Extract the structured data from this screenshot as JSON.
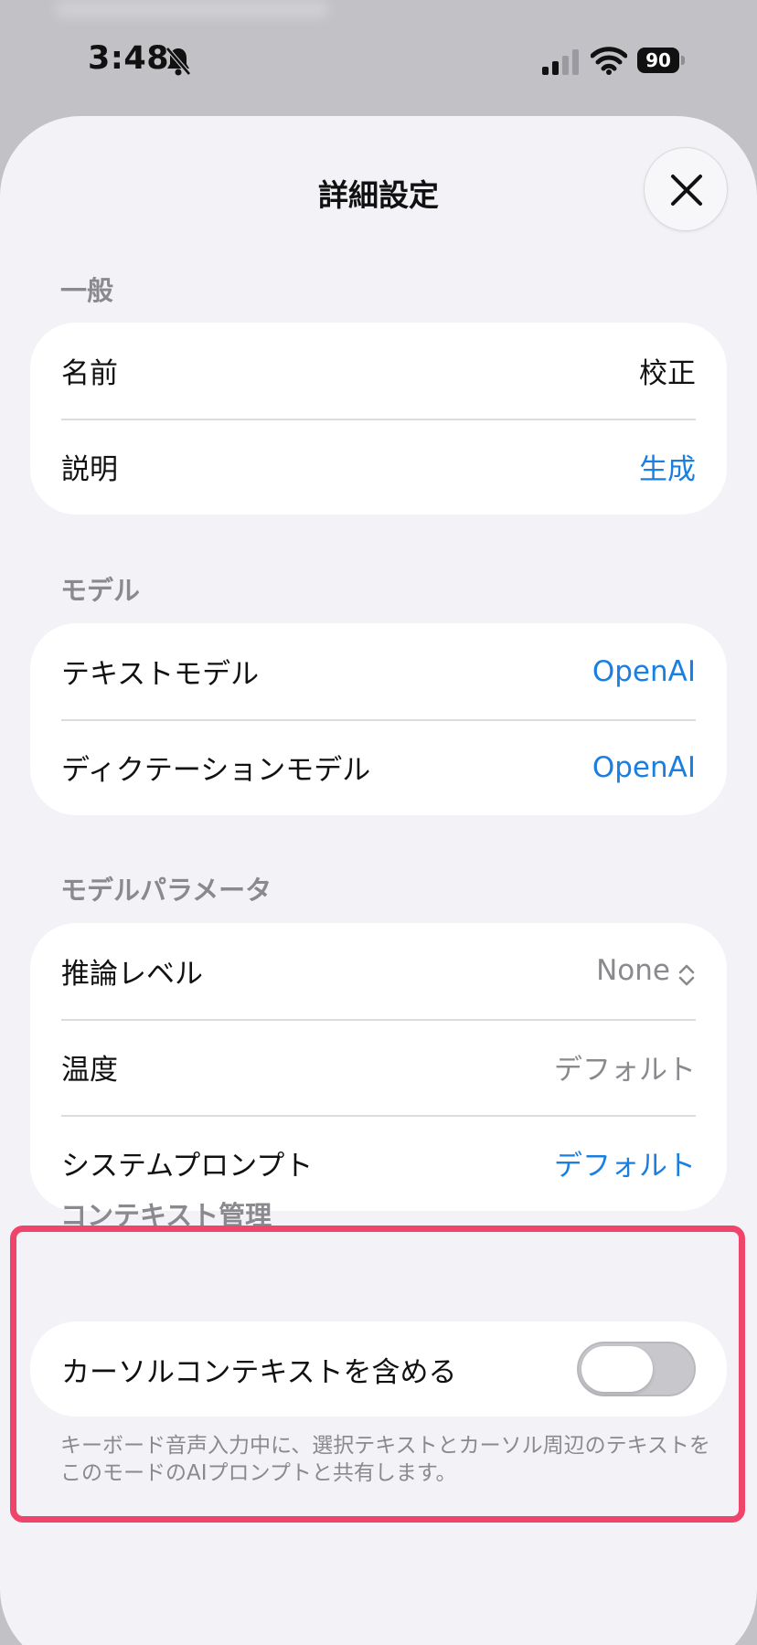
{
  "status_bar": {
    "time": "3:48",
    "battery": "90",
    "icons": [
      "bell-slash-icon",
      "cellular-signal-icon",
      "wifi-icon",
      "battery-icon"
    ]
  },
  "sheet": {
    "title": "詳細設定",
    "close_icon": "close-icon"
  },
  "sections": {
    "general": {
      "header": "一般",
      "rows": [
        {
          "label": "名前",
          "value": "校正"
        },
        {
          "label": "説明",
          "value": "生成"
        }
      ]
    },
    "model": {
      "header": "モデル",
      "rows": [
        {
          "label": "テキストモデル",
          "value": "OpenAI"
        },
        {
          "label": "ディクテーションモデル",
          "value": "OpenAI"
        }
      ]
    },
    "params": {
      "header": "モデルパラメータ",
      "rows": [
        {
          "label": "推論レベル",
          "value": "None"
        },
        {
          "label": "温度",
          "value": "デフォルト"
        },
        {
          "label": "システムプロンプト",
          "value": "デフォルト"
        }
      ]
    },
    "context": {
      "header": "コンテキスト管理",
      "toggle_label": "カーソルコンテキストを含める",
      "toggle_on": false,
      "footnote": "キーボード音声入力中に、選択テキストとカーソル周辺のテキストをこのモードのAIプロンプトと共有します。"
    }
  },
  "colors": {
    "accent": "#1a7fe0",
    "highlight": "#f0456a",
    "background": "#f2f2f7"
  }
}
